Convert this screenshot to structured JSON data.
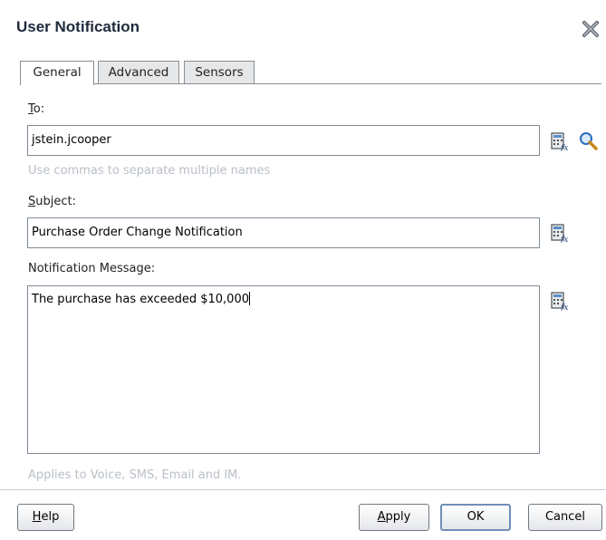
{
  "dialog": {
    "title": "User Notification",
    "close_icon": "close-icon"
  },
  "tabs": [
    {
      "label": "General",
      "active": true
    },
    {
      "label": "Advanced",
      "active": false
    },
    {
      "label": "Sensors",
      "active": false
    }
  ],
  "to": {
    "label_first": "T",
    "label_rest": "o:",
    "value": "jstein.jcooper",
    "hint": "Use commas to separate multiple names"
  },
  "subject": {
    "label_first": "S",
    "label_rest": "ubject:",
    "value": "Purchase Order Change Notification"
  },
  "message": {
    "label": "Notification Message:",
    "value": "The purchase has exceeded $10,000",
    "hint": "Applies to Voice, SMS, Email and IM."
  },
  "buttons": {
    "help_first": "H",
    "help_rest": "elp",
    "apply_first": "A",
    "apply_rest": "pply",
    "ok": "OK",
    "cancel": "Cancel"
  },
  "icons": {
    "expression_builder": "expression-builder-icon",
    "search": "search-icon"
  },
  "colors": {
    "title": "#1f2a3c",
    "hint": "#b9bfc6",
    "border": "#7f8a96"
  }
}
